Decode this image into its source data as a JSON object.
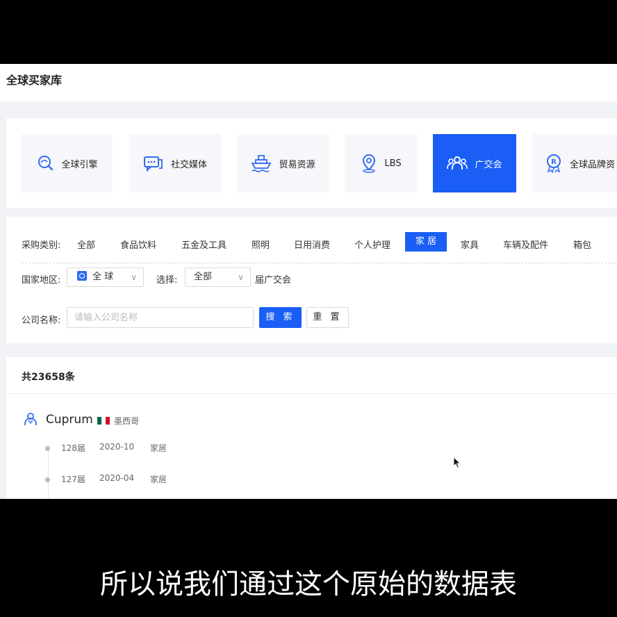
{
  "app": {
    "title": "全球买家库"
  },
  "category_cards": [
    {
      "label": "全球引擎",
      "icon": "search-globe-icon"
    },
    {
      "label": "社交媒体",
      "icon": "chat-icon"
    },
    {
      "label": "贸易资源",
      "icon": "ship-icon"
    },
    {
      "label": "LBS",
      "icon": "location-pin-icon"
    },
    {
      "label": "广交会",
      "icon": "people-icon",
      "active": true
    },
    {
      "label": "全球品牌资",
      "icon": "registered-badge-icon"
    }
  ],
  "filters": {
    "category_label": "采购类别:",
    "categories": [
      "全部",
      "食品饮料",
      "五金及工具",
      "照明",
      "日用消费",
      "个人护理",
      "家 居",
      "家具",
      "车辆及配件",
      "箱包"
    ],
    "active_category": "家 居",
    "region_label": "国家地区:",
    "region_value": "全 球",
    "session_label": "选择:",
    "session_value": "全部",
    "session_suffix": "届广交会",
    "company_label": "公司名称:",
    "company_placeholder": "请输入公司名称",
    "search_button": "搜 索",
    "reset_button": "重 置"
  },
  "results": {
    "total_text": "共23658条",
    "items": [
      {
        "name": "Cuprum",
        "country": "墨西哥",
        "flag_colors": [
          "#006847",
          "#ffffff",
          "#ce1126"
        ],
        "sessions": [
          {
            "session": "128届",
            "date": "2020-10",
            "category": "家居"
          },
          {
            "session": "127届",
            "date": "2020-04",
            "category": "家居"
          }
        ]
      }
    ]
  },
  "subtitle": "所以说我们通过这个原始的数据表",
  "colors": {
    "accent": "#1a5ef5",
    "background": "#f2f3f7"
  }
}
